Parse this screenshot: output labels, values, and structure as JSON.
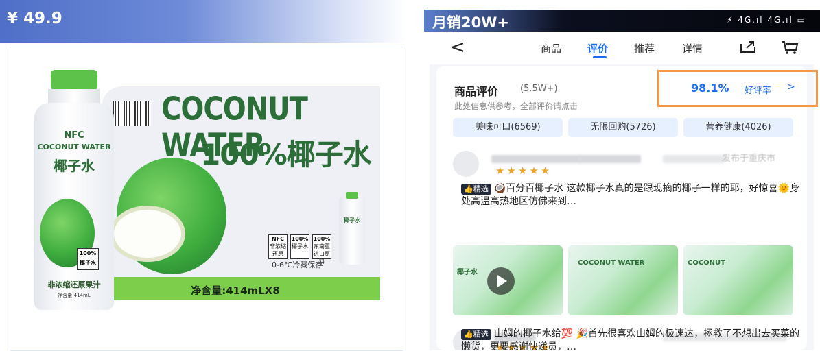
{
  "left": {
    "price": "¥ 49.9",
    "banner_title_en": "COCONUT WATER",
    "banner_title_cn": "100%椰子水",
    "net_content": "净含量:414mLX8",
    "storage": "0-6℃冷藏保存",
    "badges": [
      {
        "top": "NFC",
        "bottom": "非浓缩还原"
      },
      {
        "top": "100%",
        "bottom": "椰子水"
      },
      {
        "top": "100%",
        "bottom": "东南亚进口原料"
      }
    ],
    "bottle": {
      "nfc": "NFC",
      "name_en": "COCONUT WATER",
      "name_cn": "椰子水",
      "label_pct": "100%",
      "label_cn": "椰子水",
      "desc": "非浓缩还原果汁",
      "volume": "净含量:414mL"
    },
    "small_bottle": {
      "text": "椰子水"
    }
  },
  "right": {
    "sales": "月销20W+",
    "status_icons": "⚡ 4G.ıl 4G.ıl ▭",
    "nav": {
      "back": "<",
      "tabs": [
        "商品",
        "评价",
        "推荐",
        "详情"
      ],
      "active_tab": "评价"
    },
    "reviews_header": {
      "title": "商品评价",
      "count": "(5.5W+)",
      "note": "此处信息供参考，全部评价请点击",
      "rate": "98.1%",
      "rate_label": "好评率",
      "rate_arrow": ">"
    },
    "chips": [
      "美味可口(6569)",
      "无限回购(5726)",
      "营养健康(4026)"
    ],
    "review1": {
      "location": "发布于重庆市",
      "stars": "★★★★★",
      "tag": "👍精选",
      "text": "🥥百分百椰子水 这款椰子水真的是跟现摘的椰子一样的耶，好惊喜🌞身处高温高热地区仿佛来到…",
      "photos": [
        "椰子水",
        "COCONUT WATER",
        "COCONUT"
      ]
    },
    "review2": {
      "stars": "★★★★★",
      "tag": "👍精选",
      "text": "山姆的椰子水给💯 🎉首先很喜欢山姆的极速达，拯救了不想出去买菜的懒货，更要感谢快递员，…"
    }
  }
}
